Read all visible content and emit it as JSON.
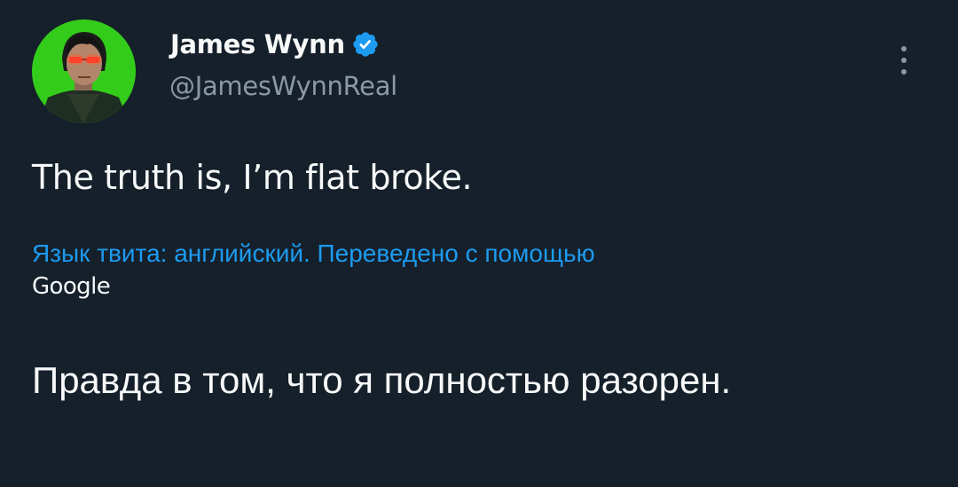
{
  "user": {
    "display_name": "James Wynn",
    "handle": "@JamesWynnReal",
    "verified": true,
    "verified_color": "#1d9bf0"
  },
  "tweet": {
    "text": "The truth is, I’m flat broke."
  },
  "translation": {
    "note": "Язык твита: английский. Переведено с помощью",
    "provider": "Google",
    "text": "Правда в том, что я полностью разорен."
  },
  "menu": {
    "icon": "more-vertical-icon"
  },
  "colors": {
    "background": "#15202b",
    "text_primary": "#f7f9f9",
    "text_secondary": "#8b98a5",
    "link": "#1d9bf0",
    "avatar_background": "#33cc1a"
  }
}
